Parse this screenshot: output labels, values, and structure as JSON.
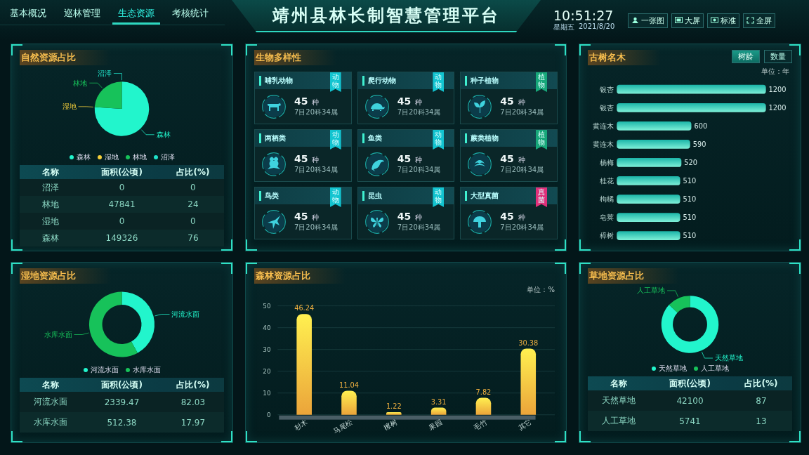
{
  "header": {
    "tabs": [
      {
        "label": "基本概况",
        "selected": false
      },
      {
        "label": "巡林管理",
        "selected": false
      },
      {
        "label": "生态资源",
        "selected": true
      },
      {
        "label": "考核统计",
        "selected": false
      }
    ],
    "title": "靖州县林长制智慧管理平台",
    "time": "10:51:27",
    "weekday": "星期五",
    "date": "2021/8/20",
    "buttons": [
      {
        "label": "一张图"
      },
      {
        "label": "大屏"
      },
      {
        "label": "标准"
      },
      {
        "label": "全屏"
      }
    ]
  },
  "natural": {
    "title": "自然资源占比",
    "chart_data": {
      "type": "pie",
      "categories": [
        "森林",
        "湿地",
        "林地",
        "沼泽"
      ],
      "values": [
        76,
        0,
        24,
        0
      ]
    },
    "legend": [
      {
        "label": "森林",
        "color": "#22f5cc"
      },
      {
        "label": "湿地",
        "color": "#f5cf3a"
      },
      {
        "label": "林地",
        "color": "#17c25a"
      },
      {
        "label": "沼泽",
        "color": "#1fe0c8"
      }
    ],
    "table": {
      "columns": [
        "名称",
        "面积(公顷)",
        "占比(%)"
      ],
      "rows": [
        [
          "沼泽",
          "0",
          "0"
        ],
        [
          "林地",
          "47841",
          "24"
        ],
        [
          "湿地",
          "0",
          "0"
        ],
        [
          "森林",
          "149326",
          "76"
        ]
      ]
    }
  },
  "biodiversity": {
    "title": "生物多样性",
    "cards": [
      {
        "name": "哺乳动物",
        "tag": "动物",
        "color": "#12c4d0",
        "count": "45",
        "unit": "种",
        "detail": "7目20科34属"
      },
      {
        "name": "爬行动物",
        "tag": "动物",
        "color": "#12c4d0",
        "count": "45",
        "unit": "种",
        "detail": "7目20科34属"
      },
      {
        "name": "种子植物",
        "tag": "植物",
        "color": "#17a87a",
        "count": "45",
        "unit": "种",
        "detail": "7目20科34属"
      },
      {
        "name": "两栖类",
        "tag": "动物",
        "color": "#12c4d0",
        "count": "45",
        "unit": "种",
        "detail": "7目20科34属"
      },
      {
        "name": "鱼类",
        "tag": "动物",
        "color": "#12c4d0",
        "count": "45",
        "unit": "种",
        "detail": "7目20科34属"
      },
      {
        "name": "蕨类植物",
        "tag": "植物",
        "color": "#17a87a",
        "count": "45",
        "unit": "种",
        "detail": "7目20科34属"
      },
      {
        "name": "鸟类",
        "tag": "动物",
        "color": "#12c4d0",
        "count": "45",
        "unit": "种",
        "detail": "7目20科34属"
      },
      {
        "name": "昆虫",
        "tag": "动物",
        "color": "#12c4d0",
        "count": "45",
        "unit": "种",
        "detail": "7目20科34属"
      },
      {
        "name": "大型真菌",
        "tag": "真菌",
        "color": "#e0307a",
        "count": "45",
        "unit": "种",
        "detail": "7目20科34属"
      }
    ]
  },
  "trees": {
    "title": "古树名木",
    "buttons": [
      {
        "label": "树龄",
        "selected": true
      },
      {
        "label": "数量",
        "selected": false
      }
    ],
    "unit": "单位：年",
    "chart_data": {
      "type": "bar",
      "orientation": "horizontal",
      "categories": [
        "银杏",
        "银杏",
        "黄连木",
        "黄连木",
        "杨梅",
        "桂花",
        "枸橘",
        "皂荚",
        "樟树"
      ],
      "values": [
        1200,
        1200,
        600,
        590,
        520,
        510,
        510,
        510,
        510
      ],
      "data_labels": true
    }
  },
  "wetland": {
    "title": "湿地资源占比",
    "chart_data": {
      "type": "donut",
      "categories": [
        "河流水面",
        "水库水面"
      ],
      "values": [
        42,
        58
      ]
    },
    "legend": [
      {
        "label": "河流水面",
        "color": "#22f5cc"
      },
      {
        "label": "水库水面",
        "color": "#17c25a"
      }
    ],
    "table": {
      "columns": [
        "名称",
        "面积(公顷)",
        "占比(%)"
      ],
      "rows": [
        [
          "河流水面",
          "2339.47",
          "82.03"
        ],
        [
          "水库水面",
          "512.38",
          "17.97"
        ]
      ]
    }
  },
  "forest": {
    "title": "森林资源占比",
    "unit": "单位：%",
    "chart_data": {
      "type": "bar",
      "categories": [
        "杉木",
        "马尾松",
        "檫树",
        "果园",
        "毛竹",
        "其它"
      ],
      "values": [
        46.24,
        11.04,
        1.22,
        3.31,
        7.82,
        30.38
      ],
      "yticks": [
        0,
        10,
        20,
        30,
        40,
        50
      ],
      "ylim": [
        0,
        50
      ],
      "grid": true,
      "data_labels": true
    }
  },
  "grass": {
    "title": "草地资源占比",
    "chart_data": {
      "type": "donut",
      "categories": [
        "天然草地",
        "人工草地"
      ],
      "values": [
        87,
        13
      ]
    },
    "legend": [
      {
        "label": "天然草地",
        "color": "#22f5cc"
      },
      {
        "label": "人工草地",
        "color": "#17c25a"
      }
    ],
    "table": {
      "columns": [
        "名称",
        "面积(公顷)",
        "占比(%)"
      ],
      "rows": [
        [
          "天然草地",
          "42100",
          "87"
        ],
        [
          "人工草地",
          "5741",
          "13"
        ]
      ]
    }
  }
}
